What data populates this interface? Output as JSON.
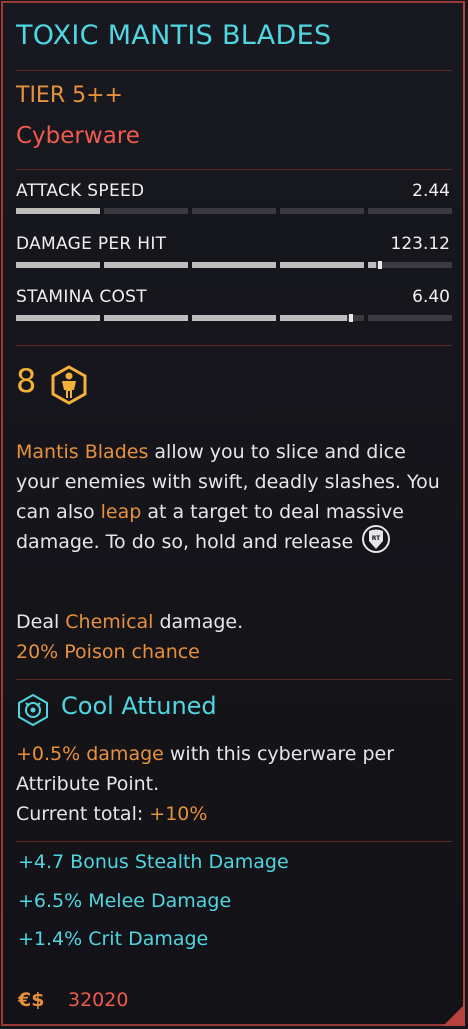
{
  "item": {
    "name": "TOXIC MANTIS BLADES",
    "tier": "TIER 5++",
    "category": "Cyberware"
  },
  "stats": [
    {
      "label": "ATTACK SPEED",
      "value": "2.44",
      "fill": 0.2
    },
    {
      "label": "DAMAGE PER HIT",
      "value": "123.12",
      "fill": 0.82
    },
    {
      "label": "STAMINA COST",
      "value": "6.40",
      "fill": 0.76
    }
  ],
  "requirement": {
    "level": "8",
    "icon": "body-attribute-icon"
  },
  "description": {
    "p1_kw1": "Mantis Blades",
    "p1_t1": " allow you to slice and dice your enemies with swift, deadly slashes. You can also ",
    "p1_kw2": "leap",
    "p1_t2": " at a target to deal massive damage. To do so, hold and release",
    "button_icon": "rt-button-icon",
    "deal_prefix": "Deal ",
    "deal_keyword": "Chemical",
    "deal_suffix": " damage.",
    "poison": "20% Poison chance"
  },
  "attunement": {
    "title": "Cool Attuned",
    "icon": "cool-attribute-icon",
    "line_kw": "+0.5% damage",
    "line_text": " with this cyberware per Attribute Point.",
    "total_label": "Current total: ",
    "total_value": "+10%"
  },
  "bonuses": [
    "+4.7  Bonus Stealth Damage",
    "+6.5%  Melee Damage",
    "+1.4%  Crit Damage"
  ],
  "price": {
    "currency_symbol": "€$",
    "amount": "32020"
  },
  "colors": {
    "cyan": "#4fd6e0",
    "orange": "#e8913c",
    "red": "#f05a4f",
    "gold": "#f2b13a",
    "border": "#9a3a36"
  }
}
